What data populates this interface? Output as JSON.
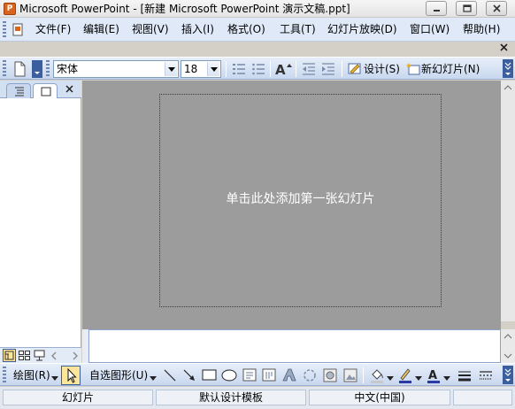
{
  "window": {
    "app_icon": "powerpoint-icon",
    "title": "Microsoft PowerPoint - [新建 Microsoft PowerPoint 演示文稿.ppt]"
  },
  "menu": {
    "items": [
      {
        "label": "文件(F)"
      },
      {
        "label": "编辑(E)"
      },
      {
        "label": "视图(V)"
      },
      {
        "label": "插入(I)"
      },
      {
        "label": "格式(O)"
      },
      {
        "label": "工具(T)"
      },
      {
        "label": "幻灯片放映(D)"
      },
      {
        "label": "窗口(W)"
      },
      {
        "label": "帮助(H)"
      }
    ]
  },
  "formatting_toolbar": {
    "font_name": "宋体",
    "font_size": "18",
    "design_label": "设计(S)",
    "new_slide_label": "新幻灯片(N)"
  },
  "slide": {
    "placeholder": "单击此处添加第一张幻灯片"
  },
  "drawing_toolbar": {
    "draw_label": "绘图(R)",
    "autoshapes_label": "自选图形(U)"
  },
  "status": {
    "slide": "幻灯片",
    "template": "默认设计模板",
    "language": "中文(中国)"
  },
  "colors": {
    "toolbar_blue": "#c9d8ef",
    "slide_area": "#9c9c9c",
    "accent_orange": "#d9641e"
  }
}
